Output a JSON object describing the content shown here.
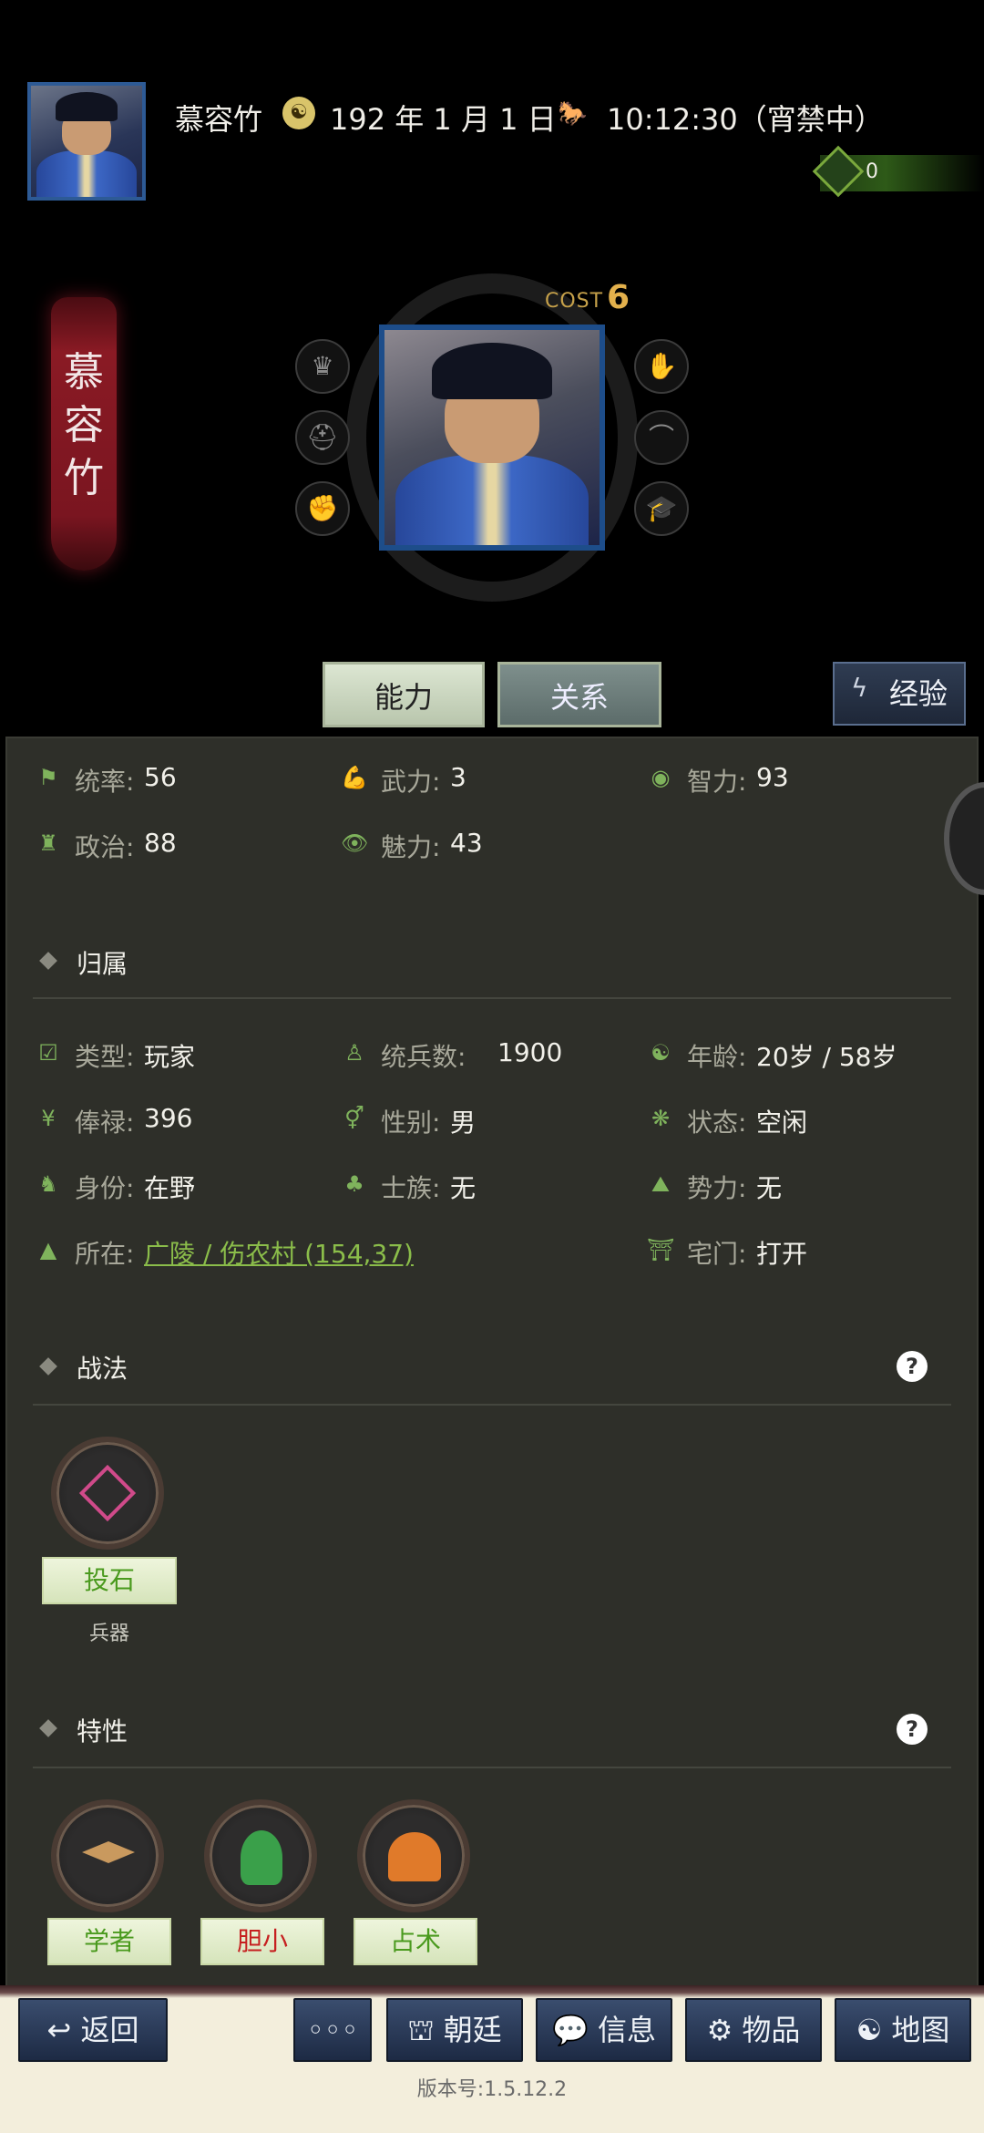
{
  "header": {
    "player_name": "慕容竹",
    "date": "192 年 1 月 1 日",
    "time": "10:12:30（宵禁中）",
    "gem_count": "0"
  },
  "hero": {
    "name_vertical": [
      "慕",
      "容",
      "竹"
    ],
    "cost_label": "COST",
    "cost_value": "6"
  },
  "tabs": {
    "ability": "能力",
    "relation": "关系",
    "experience": "经验"
  },
  "stats": [
    {
      "label": "统率:",
      "value": "56"
    },
    {
      "label": "武力:",
      "value": "3"
    },
    {
      "label": "智力:",
      "value": "93"
    },
    {
      "label": "政治:",
      "value": "88"
    },
    {
      "label": "魅力:",
      "value": "43"
    }
  ],
  "affiliation": {
    "title": "归属",
    "rows": [
      {
        "label": "类型:",
        "value": "玩家"
      },
      {
        "label": "统兵数:",
        "value": "1900"
      },
      {
        "label": "年龄:",
        "value": "20岁 / 58岁"
      },
      {
        "label": "俸禄:",
        "value": "396"
      },
      {
        "label": "性别:",
        "value": "男"
      },
      {
        "label": "状态:",
        "value": "空闲"
      },
      {
        "label": "身份:",
        "value": "在野"
      },
      {
        "label": "士族:",
        "value": "无"
      },
      {
        "label": "势力:",
        "value": "无"
      }
    ],
    "location_label": "所在:",
    "location_value": "广陵 / 伤农村 (154,37)",
    "gate_label": "宅门:",
    "gate_value": "打开"
  },
  "tactics": {
    "title": "战法",
    "help": "?",
    "items": [
      {
        "label": "投石",
        "sub": "兵器",
        "color": "#4a9a1e"
      }
    ]
  },
  "traits": {
    "title": "特性",
    "help": "?",
    "items": [
      {
        "label": "学者",
        "color": "#4a9a1e"
      },
      {
        "label": "胆小",
        "color": "#c62020"
      },
      {
        "label": "占术",
        "color": "#4a9a1e"
      }
    ]
  },
  "nav": {
    "back": "返回",
    "more": "◦◦◦",
    "court": "朝廷",
    "info": "信息",
    "items": "物品",
    "map": "地图"
  },
  "version": "版本号:1.5.12.2"
}
